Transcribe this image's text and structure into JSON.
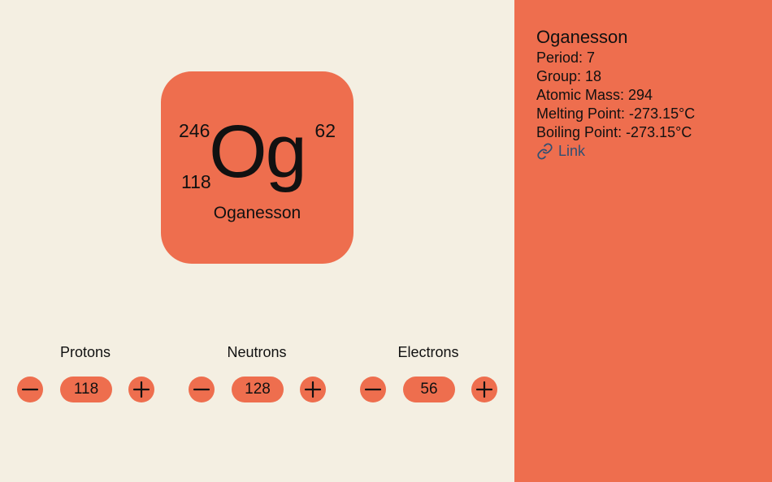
{
  "element": {
    "symbol": "Og",
    "name": "Oganesson",
    "mass_number": "246",
    "atomic_number": "118",
    "charge_number": "62"
  },
  "counters": [
    {
      "label": "Protons",
      "value": "118"
    },
    {
      "label": "Neutrons",
      "value": "128"
    },
    {
      "label": "Electrons",
      "value": "56"
    }
  ],
  "info": {
    "name": "Oganesson",
    "period": "Period: 7",
    "group": "Group: 18",
    "atomic_mass": "Atomic Mass: 294",
    "melting_point": "Melting Point: -273.15°C",
    "boiling_point": "Boiling Point: -273.15°C",
    "link_label": "Link",
    "link_icon": "link-icon"
  },
  "colors": {
    "background": "#f4efe2",
    "accent": "#ee6e4e",
    "link": "#2f4f73"
  },
  "icons": {
    "decrement": "minus-icon",
    "increment": "plus-icon"
  }
}
